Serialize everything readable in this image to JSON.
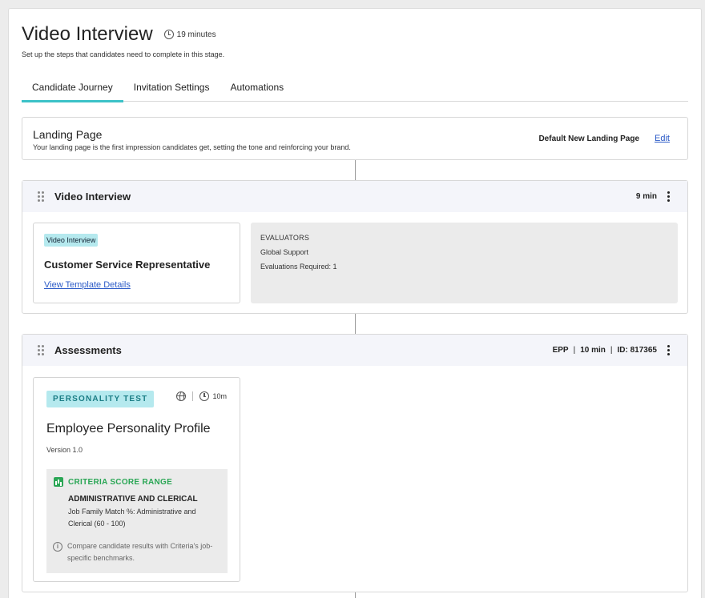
{
  "header": {
    "title": "Video Interview",
    "duration": "19 minutes",
    "subtitle": "Set up the steps that candidates need to complete in this stage."
  },
  "tabs": [
    {
      "label": "Candidate Journey",
      "active": true
    },
    {
      "label": "Invitation Settings",
      "active": false
    },
    {
      "label": "Automations",
      "active": false
    }
  ],
  "landing": {
    "title": "Landing Page",
    "description": "Your landing page is the first impression candidates get, setting the tone and reinforcing your brand.",
    "value": "Default New Landing Page",
    "edit_label": "Edit"
  },
  "video_section": {
    "title": "Video Interview",
    "duration": "9 min",
    "template": {
      "tag": "Video Interview",
      "name": "Customer Service Representative",
      "link": "View Template Details"
    },
    "evaluators": {
      "heading": "EVALUATORS",
      "group": "Global Support",
      "required": "Evaluations Required: 1"
    }
  },
  "assessments_section": {
    "title": "Assessments",
    "code": "EPP",
    "duration": "10 min",
    "id": "ID: 817365",
    "card": {
      "tag": "PERSONALITY TEST",
      "time": "10m",
      "name": "Employee Personality Profile",
      "version": "Version 1.0",
      "criteria": {
        "heading": "CRITERIA SCORE RANGE",
        "title": "ADMINISTRATIVE AND CLERICAL",
        "description": "Job Family Match %: Administrative and Clerical (60 - 100)",
        "info": "Compare candidate results with Criteria's job-specific benchmarks."
      }
    }
  },
  "colors": {
    "accent": "#3cc2c8",
    "link": "#2c5bc7",
    "tag_bg": "#b5e9ee",
    "criteria_green": "#2aa655"
  }
}
